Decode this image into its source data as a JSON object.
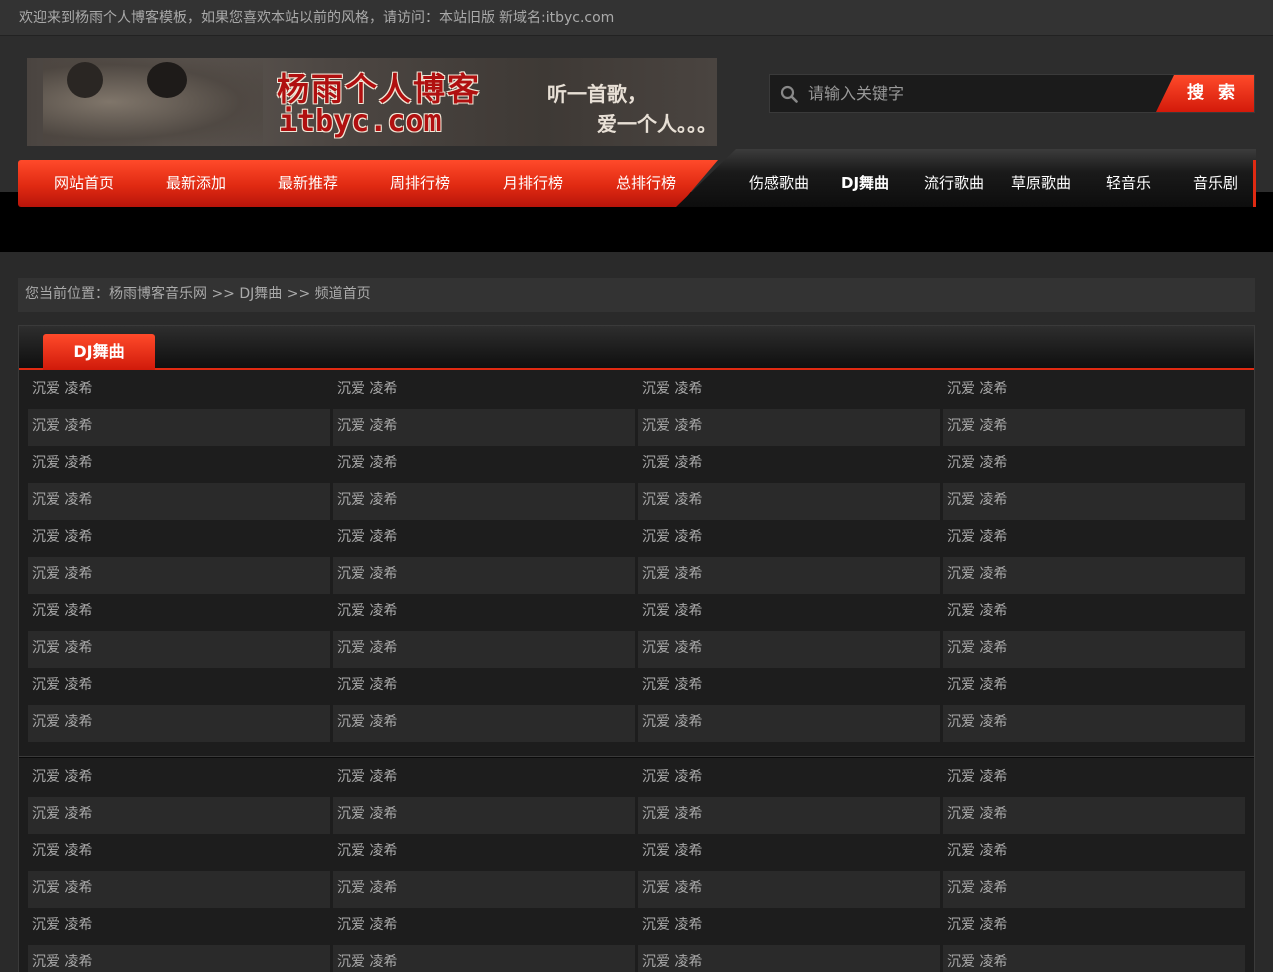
{
  "topbar": {
    "welcome": "欢迎来到杨雨个人博客模板，如果您喜欢本站以前的风格，请访问：",
    "old_site": "本站旧版",
    "new_domain": "新域名:itbyc.com"
  },
  "banner": {
    "title_cn": "杨雨个人博客",
    "title_domain": "itbyc.com",
    "slogan_line1": "听一首歌，",
    "slogan_line2": "爱一个人。。。"
  },
  "search": {
    "placeholder": "请输入关键字",
    "button": "搜 索"
  },
  "nav": {
    "primary": [
      "网站首页",
      "最新添加",
      "最新推荐",
      "周排行榜",
      "月排行榜",
      "总排行榜"
    ],
    "categories": [
      "伤感歌曲",
      "DJ舞曲",
      "流行歌曲",
      "草原歌曲",
      "轻音乐",
      "音乐剧"
    ],
    "active_category": "DJ舞曲"
  },
  "breadcrumb": {
    "prefix": "您当前位置：",
    "site": "杨雨博客音乐网",
    "sep1": " >> ",
    "category": "DJ舞曲",
    "sep2": " >> ",
    "page": "频道首页"
  },
  "panel": {
    "tab": "DJ舞曲",
    "song_title": "沉爱 凌希",
    "columns": 4,
    "group1_rows": 10,
    "group2_rows": 6
  },
  "colors": {
    "accent_red": "#e02a12",
    "background": "#2a2a2a",
    "text": "#aaaaaa"
  }
}
